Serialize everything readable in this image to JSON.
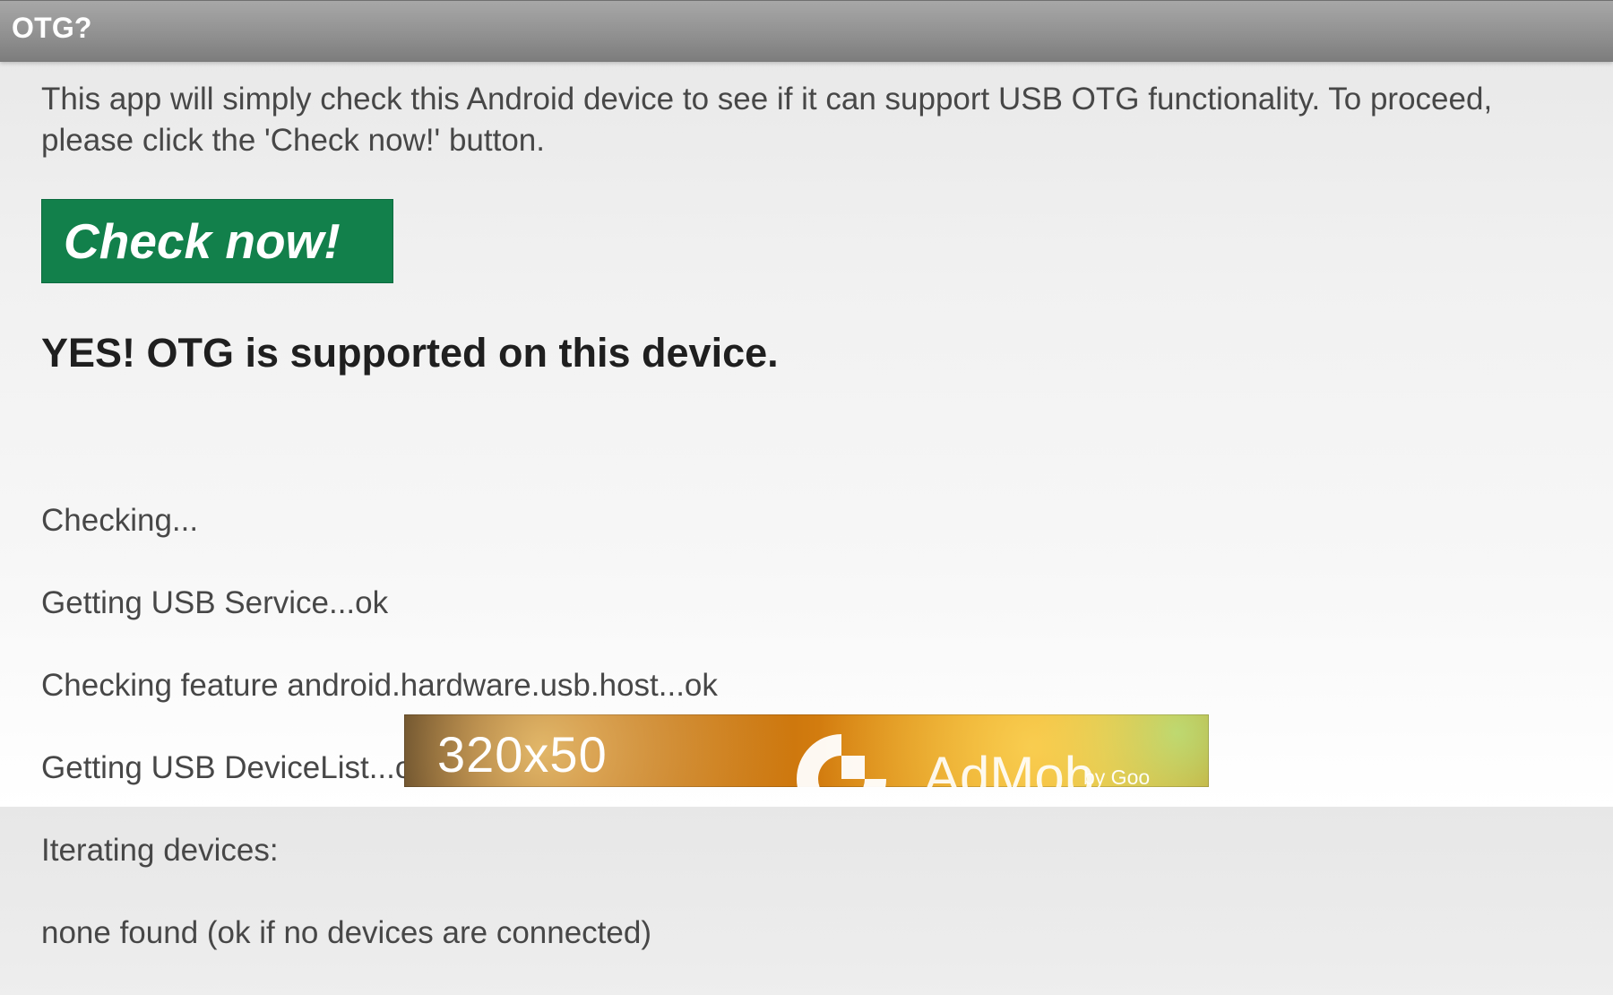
{
  "app": {
    "title": "OTG?"
  },
  "main": {
    "intro_text": "This app will simply check this Android device to see if it can support USB OTG functionality. To proceed, please click the 'Check now!' button.",
    "check_button_label": "Check now!",
    "result_text": "YES! OTG is supported on this device.",
    "log_lines": [
      "Checking...",
      "Getting USB Service...ok",
      "Checking feature android.hardware.usb.host...ok",
      "Getting USB DeviceList...ok",
      "Iterating devices:",
      "none found (ok if no devices are connected)"
    ]
  },
  "ad_banner": {
    "size_text": "320x50",
    "brand_text": "AdMob",
    "brand_suffix": "by Goo",
    "logo_icon": "admob-logo-icon"
  },
  "colors": {
    "titlebar": "#8f8f8f",
    "button": "#12804b",
    "background": "#f1f1f1",
    "text": "#474747"
  }
}
